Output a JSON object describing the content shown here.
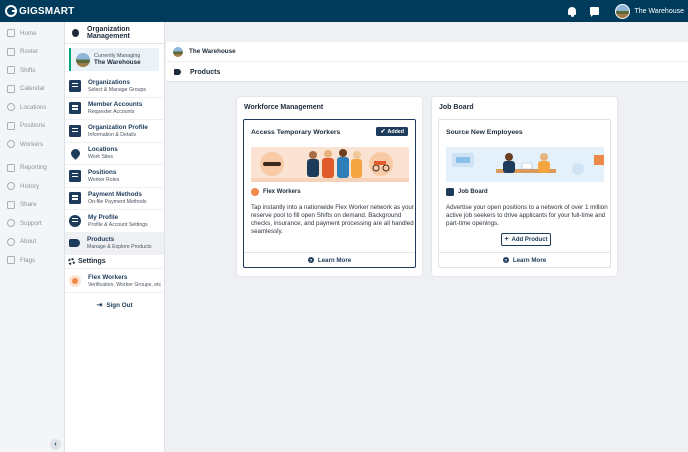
{
  "topbar": {
    "logo": "GIGSMART",
    "user_name": "The Warehouse"
  },
  "leftnav": {
    "items": [
      "Home",
      "Roster",
      "Shifts",
      "Calendar",
      "Locations",
      "Positions",
      "Workers",
      "Reporting",
      "History",
      "Share",
      "Support",
      "About",
      "Flags"
    ]
  },
  "org": {
    "header": "Organization Management",
    "managing_label": "Currently Managing",
    "managing_name": "The Warehouse",
    "menu": [
      {
        "title": "Organizations",
        "subtitle": "Select & Manage Groups"
      },
      {
        "title": "Member Accounts",
        "subtitle": "Requester Accounts"
      },
      {
        "title": "Organization Profile",
        "subtitle": "Information & Details"
      },
      {
        "title": "Locations",
        "subtitle": "Work Sites"
      },
      {
        "title": "Positions",
        "subtitle": "Worker Roles"
      },
      {
        "title": "Payment Methods",
        "subtitle": "On-file Payment Methods"
      },
      {
        "title": "My Profile",
        "subtitle": "Profile & Account Settings"
      },
      {
        "title": "Products",
        "subtitle": "Manage & Explore Products"
      }
    ],
    "settings_label": "Settings",
    "flex": {
      "title": "Flex Workers",
      "subtitle": "Verification, Worker Groups, etc"
    },
    "sign_out": "Sign Out"
  },
  "breadcrumbs": {
    "org": "The Warehouse",
    "page": "Products"
  },
  "workforce": {
    "header": "Workforce Management",
    "card_title": "Access Temporary Workers",
    "badge": "Added",
    "brand": "Flex Workers",
    "desc_lines": [
      "Tap instantly into a nationwide Flex Worker network as your",
      "reserve pool to fill open Shifts on demand. Background",
      "checks, insurance, and payment processing are all handled",
      "seamlessly."
    ],
    "learn_more": "Learn More"
  },
  "jobboard": {
    "header": "Job Board",
    "card_title": "Source New Employees",
    "brand": "Job Board",
    "desc_lines": [
      "Advertise your open positions to a network of over 1 million",
      "active job seekers to drive applicants for your full-time and",
      "part-time openings."
    ],
    "add_product": "Add Product",
    "learn_more": "Learn More"
  }
}
